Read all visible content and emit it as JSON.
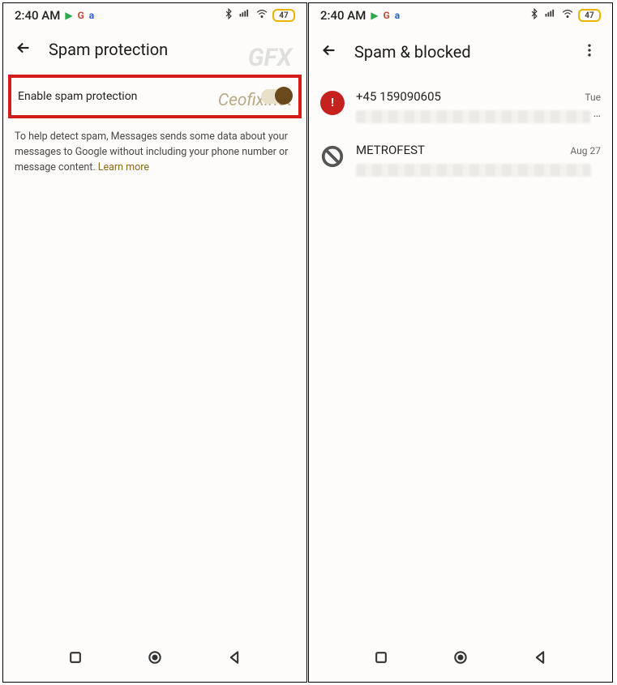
{
  "status": {
    "time": "2:40 AM",
    "battery": "47"
  },
  "left": {
    "title": "Spam protection",
    "toggle_label": "Enable spam protection",
    "toggle_on": true,
    "info_text": "To help detect spam, Messages sends some data about your messages to Google without including your phone number or message content. ",
    "learn_more": "Learn more",
    "watermark_small": "Ceofix.net"
  },
  "right": {
    "title": "Spam & blocked",
    "items": [
      {
        "sender": "+45 159090605",
        "date": "Tue",
        "icon": "alert"
      },
      {
        "sender": "METROFEST",
        "date": "Aug 27",
        "icon": "block"
      }
    ]
  }
}
